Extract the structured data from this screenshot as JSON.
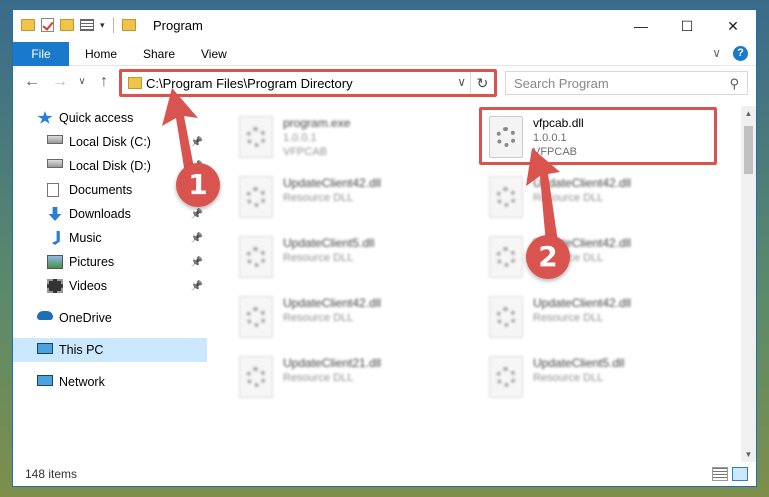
{
  "window": {
    "title": "Program",
    "controls": {
      "minimize": "—",
      "maximize": "☐",
      "close": "✕"
    }
  },
  "ribbon": {
    "tabs": [
      "File",
      "Home",
      "Share",
      "View"
    ],
    "expand_icon": "chevron-down-icon",
    "help_icon": "?"
  },
  "nav": {
    "back": "←",
    "forward": "→",
    "recent": "∨",
    "up": "↑",
    "address": "C:\\Program Files\\Program Directory",
    "address_dropdown": "∨",
    "refresh": "↻",
    "search_placeholder": "Search Program",
    "search_icon": "⚲"
  },
  "sidebar": {
    "items": [
      {
        "label": "Quick access",
        "icon": "star-icon",
        "pinned": false
      },
      {
        "label": "Local Disk (C:)",
        "icon": "drive-icon",
        "pinned": true
      },
      {
        "label": "Local Disk (D:)",
        "icon": "drive-icon",
        "pinned": true
      },
      {
        "label": "Documents",
        "icon": "documents-icon",
        "pinned": true
      },
      {
        "label": "Downloads",
        "icon": "download-icon",
        "pinned": true
      },
      {
        "label": "Music",
        "icon": "music-icon",
        "pinned": true
      },
      {
        "label": "Pictures",
        "icon": "pictures-icon",
        "pinned": true
      },
      {
        "label": "Videos",
        "icon": "videos-icon",
        "pinned": true
      },
      {
        "label": "OneDrive",
        "icon": "cloud-icon",
        "pinned": false
      },
      {
        "label": "This PC",
        "icon": "computer-icon",
        "pinned": false,
        "selected": true
      },
      {
        "label": "Network",
        "icon": "network-icon",
        "pinned": false
      }
    ],
    "pin_glyph": "📌"
  },
  "files": [
    {
      "name": "program.exe",
      "line2": "1.0.0.1",
      "line3": "VFPCAB",
      "blurred": true
    },
    {
      "name": "vfpcab.dll",
      "line2": "1.0.0.1",
      "line3": "VFPCAB",
      "blurred": false,
      "highlighted": true
    },
    {
      "name": "UpdateClient42.dll",
      "line2": "Resource DLL",
      "line3": "",
      "blurred": true
    },
    {
      "name": "UpdateClient42.dll",
      "line2": "Resource DLL",
      "line3": "",
      "blurred": true
    },
    {
      "name": "UpdateClient5.dll",
      "line2": "Resource DLL",
      "line3": "",
      "blurred": true
    },
    {
      "name": "UpdateClient42.dll",
      "line2": "Resource DLL",
      "line3": "",
      "blurred": true
    },
    {
      "name": "UpdateClient42.dll",
      "line2": "Resource DLL",
      "line3": "",
      "blurred": true
    },
    {
      "name": "UpdateClient42.dll",
      "line2": "Resource DLL",
      "line3": "",
      "blurred": true
    },
    {
      "name": "UpdateClient21.dll",
      "line2": "Resource DLL",
      "line3": "",
      "blurred": true
    },
    {
      "name": "UpdateClient5.dll",
      "line2": "Resource DLL",
      "line3": "",
      "blurred": true
    }
  ],
  "status": {
    "count": "148 items"
  },
  "annotations": {
    "badge1": "1",
    "badge2": "2",
    "color": "#d9534f"
  }
}
